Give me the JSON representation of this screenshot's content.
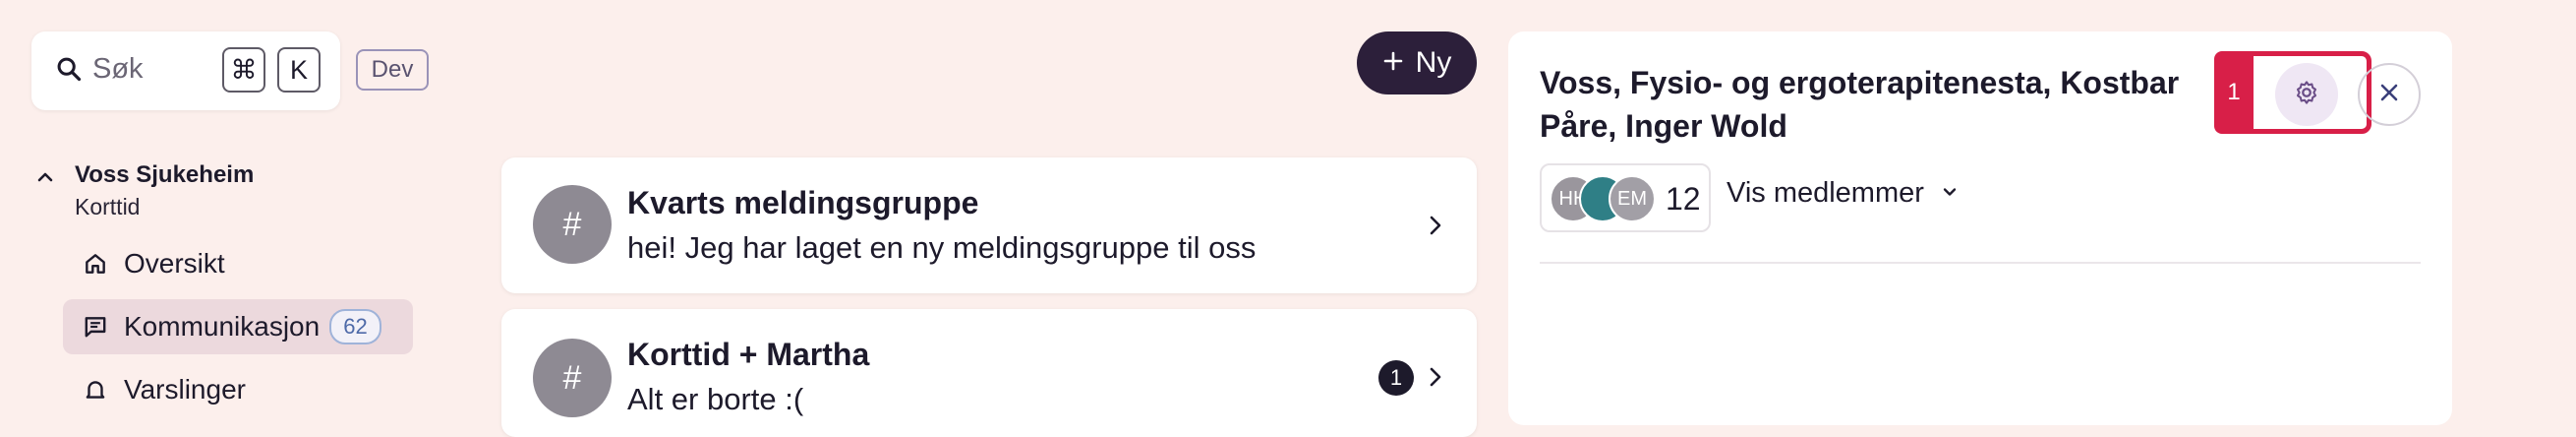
{
  "search": {
    "placeholder": "Søk",
    "key_cmd": "⌘",
    "key_k": "K"
  },
  "env_badge": "Dev",
  "sidebar": {
    "org_name": "Voss Sjukeheim",
    "org_unit": "Korttid",
    "items": [
      {
        "label": "Oversikt",
        "icon": "home-icon"
      },
      {
        "label": "Kommunikasjon",
        "icon": "chat-icon",
        "count": "62",
        "active": true
      },
      {
        "label": "Varslinger",
        "icon": "bell-icon"
      }
    ]
  },
  "new_button": {
    "label": "Ny"
  },
  "conversations": [
    {
      "avatar": "#",
      "title": "Kvarts meldingsgruppe",
      "message": "hei! Jeg har laget en ny meldingsgruppe til oss"
    },
    {
      "avatar": "#",
      "title": "Korttid + Martha",
      "message": "Alt er borte :(",
      "unread": "1"
    }
  ],
  "detail": {
    "title": "Voss, Fysio- og ergoterapitenesta, Kostbar Påre, Inger Wold",
    "members": {
      "avatars": [
        {
          "initials": "HH",
          "color": "#9a969d"
        },
        {
          "initials": "",
          "color": "#2f7f86"
        },
        {
          "initials": "EM",
          "color": "#a29fa6"
        }
      ],
      "count": "12",
      "toggle_label": "Vis medlemmer"
    },
    "highlight_tag": "1"
  },
  "colors": {
    "background": "#fcefec",
    "accent": "#2c1f3a",
    "highlight": "#d81f48"
  }
}
